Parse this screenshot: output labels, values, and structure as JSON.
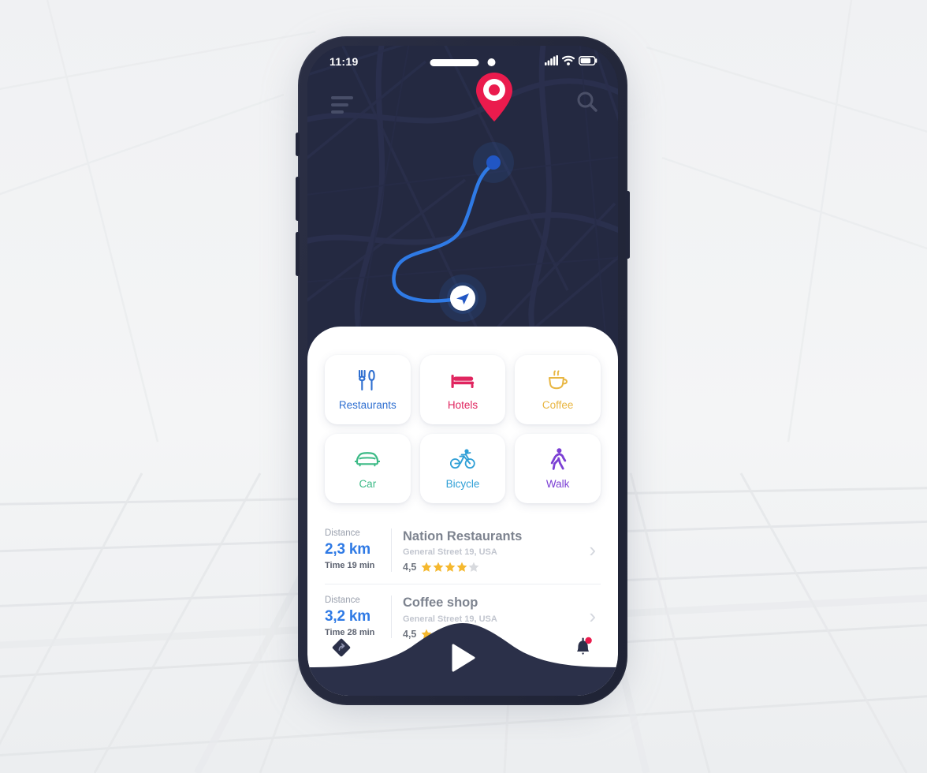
{
  "app": {
    "title": "Navigation App UI Mockup"
  },
  "status_bar": {
    "time": "11:19",
    "signal_icon": "signal-bars-icon",
    "wifi_icon": "wifi-icon",
    "battery_icon": "battery-icon"
  },
  "map": {
    "menu_icon": "hamburger-menu-icon",
    "search_icon": "search-icon",
    "destination_pin_icon": "location-pin-icon",
    "current_position_icon": "navigation-arrow-icon",
    "route_color": "#2f7ae5",
    "pin_color": "#ea1b4d",
    "background_color": "#242941"
  },
  "categories": [
    {
      "id": "restaurants",
      "label": "Restaurants",
      "icon": "fork-knife-icon",
      "color": "#2f6fd0"
    },
    {
      "id": "hotels",
      "label": "Hotels",
      "icon": "bed-icon",
      "color": "#e0255f"
    },
    {
      "id": "coffee",
      "label": "Coffee",
      "icon": "coffee-cup-icon",
      "color": "#e8b642"
    },
    {
      "id": "car",
      "label": "Car",
      "icon": "car-icon",
      "color": "#3cba86"
    },
    {
      "id": "bicycle",
      "label": "Bicycle",
      "icon": "bicycle-icon",
      "color": "#2f9fd6"
    },
    {
      "id": "walk",
      "label": "Walk",
      "icon": "walking-person-icon",
      "color": "#7b3fd4"
    }
  ],
  "places": [
    {
      "distance_label": "Distance",
      "distance_value": "2,3 km",
      "time": "Time 19 min",
      "name": "Nation Restaurants",
      "address": "General Street 19, USA",
      "rating_value": "4,5",
      "stars_filled": 4,
      "stars_total": 5
    },
    {
      "distance_label": "Distance",
      "distance_value": "3,2 km",
      "time": "Time 28 min",
      "name": "Coffee shop",
      "address": "General Street 19, USA",
      "rating_value": "4,5",
      "stars_filled": 3,
      "stars_total": 5
    }
  ],
  "bottom_nav": {
    "left_icon": "turn-arrow-diamond-icon",
    "center_icon": "play-navigate-icon",
    "right_icon": "bell-notification-icon",
    "has_notification_badge": true,
    "badge_color": "#ea1b4d",
    "bar_color": "#2b3049"
  },
  "theme": {
    "star_filled": "#f5b82e",
    "star_empty": "#d8dade",
    "accent_blue": "#2f7ae5",
    "sheet_background": "#ffffff",
    "page_background": "#f2f3f5"
  }
}
